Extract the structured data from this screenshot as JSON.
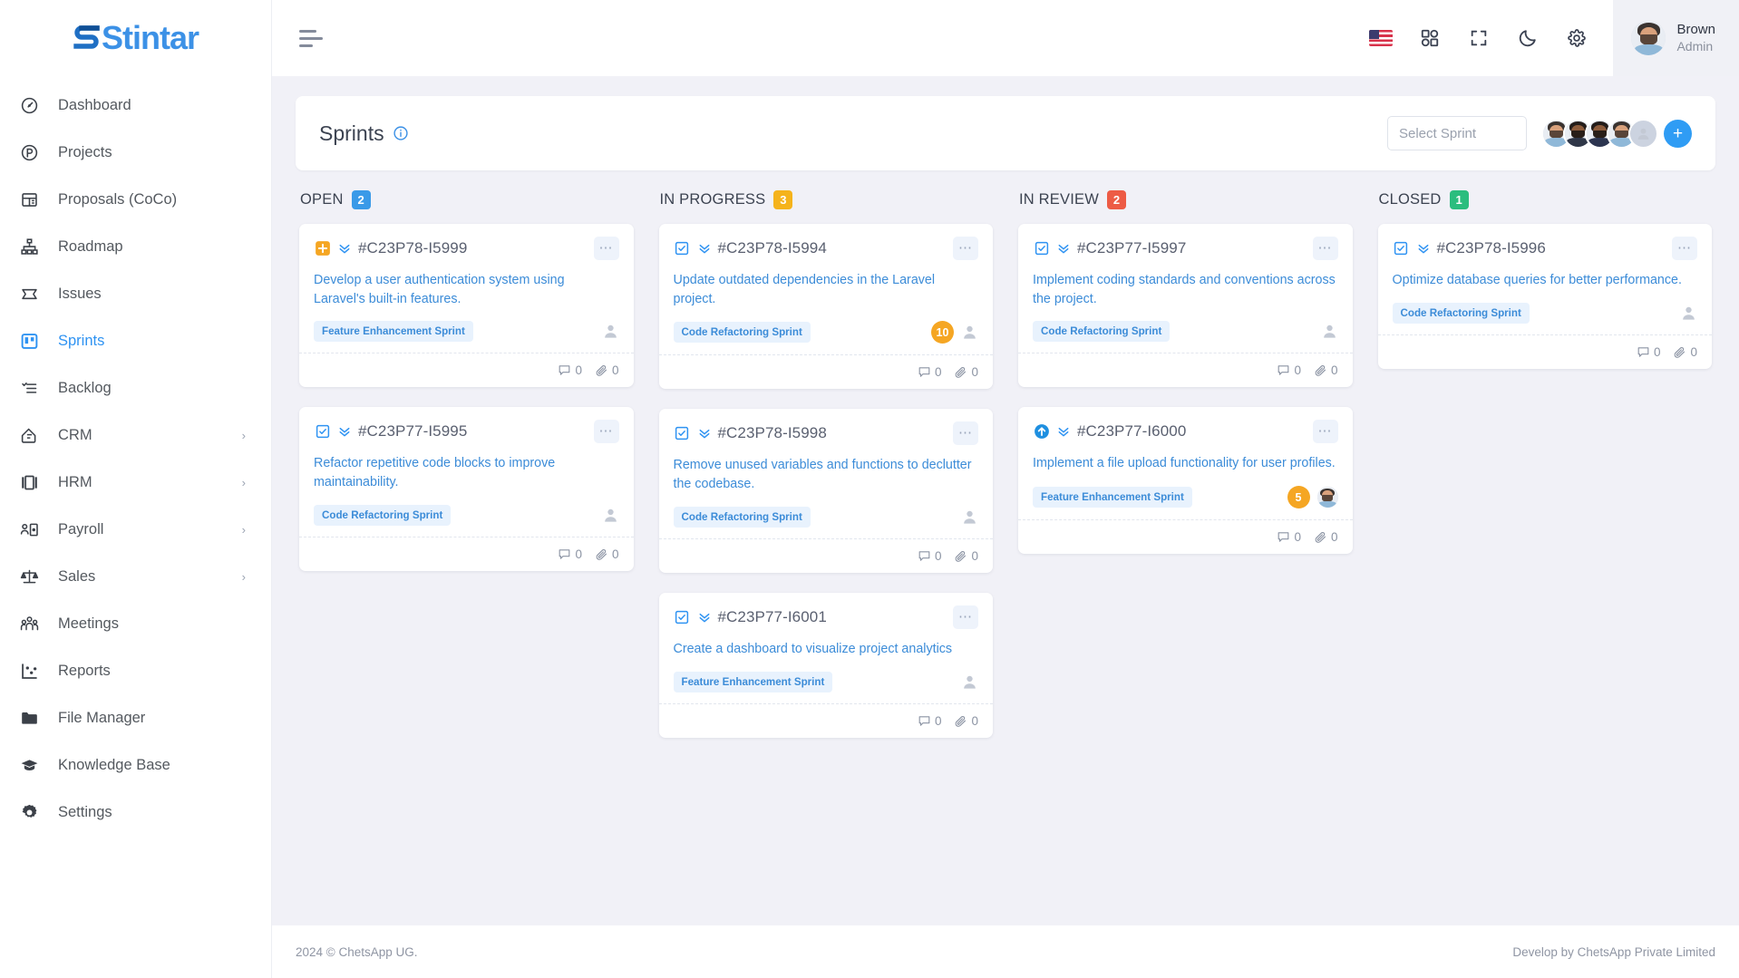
{
  "brand": {
    "logo_text": "Stintar",
    "accent": "#3c91e6"
  },
  "sidebar": {
    "items": [
      {
        "label": "Dashboard",
        "icon": "speedometer-icon",
        "has_chevron": false,
        "active": false
      },
      {
        "label": "Projects",
        "icon": "project-icon",
        "has_chevron": false,
        "active": false
      },
      {
        "label": "Proposals (CoCo)",
        "icon": "proposal-icon",
        "has_chevron": false,
        "active": false
      },
      {
        "label": "Roadmap",
        "icon": "roadmap-icon",
        "has_chevron": false,
        "active": false
      },
      {
        "label": "Issues",
        "icon": "issues-icon",
        "has_chevron": false,
        "active": false
      },
      {
        "label": "Sprints",
        "icon": "sprints-icon",
        "has_chevron": false,
        "active": true
      },
      {
        "label": "Backlog",
        "icon": "backlog-icon",
        "has_chevron": false,
        "active": false
      },
      {
        "label": "CRM",
        "icon": "crm-icon",
        "has_chevron": true,
        "active": false
      },
      {
        "label": "HRM",
        "icon": "hrm-icon",
        "has_chevron": true,
        "active": false
      },
      {
        "label": "Payroll",
        "icon": "payroll-icon",
        "has_chevron": true,
        "active": false
      },
      {
        "label": "Sales",
        "icon": "sales-icon",
        "has_chevron": true,
        "active": false
      },
      {
        "label": "Meetings",
        "icon": "meetings-icon",
        "has_chevron": false,
        "active": false
      },
      {
        "label": "Reports",
        "icon": "reports-icon",
        "has_chevron": false,
        "active": false
      },
      {
        "label": "File Manager",
        "icon": "folder-icon",
        "has_chevron": false,
        "active": false
      },
      {
        "label": "Knowledge Base",
        "icon": "graduation-icon",
        "has_chevron": false,
        "active": false
      },
      {
        "label": "Settings",
        "icon": "gear-icon",
        "has_chevron": false,
        "active": false
      }
    ],
    "chevron_glyph": "›"
  },
  "topbar": {
    "menu_icon": "hamburger-icon",
    "icons": [
      "flag-us-icon",
      "apps-grid-icon",
      "fullscreen-icon",
      "dark-mode-moon-icon",
      "gear-icon"
    ],
    "profile": {
      "name": "Brown",
      "role": "Admin"
    }
  },
  "page": {
    "title": "Sprints",
    "info_icon": "info-icon",
    "select_sprint_placeholder": "Select Sprint",
    "add_button_label": "+",
    "member_avatars": 4,
    "member_placeholder_avatar": true
  },
  "board": {
    "columns": [
      {
        "title": "OPEN",
        "count": "2",
        "count_color": "#3a9ae8",
        "cards": [
          {
            "type_icon": "plus-square-icon",
            "type_color": "#f5a623",
            "priority_icon": "double-chevron-down-icon",
            "id": "#C23P78-I5999",
            "description": "Develop a user authentication system using Laravel's built-in features.",
            "tag": "Feature Enhancement Sprint",
            "points": null,
            "assignee": "placeholder",
            "comments": "0",
            "attachments": "0"
          },
          {
            "type_icon": "task-clipboard-icon",
            "type_color": "#2f93f2",
            "priority_icon": "double-chevron-down-icon",
            "id": "#C23P77-I5995",
            "description": "Refactor repetitive code blocks to improve maintainability.",
            "tag": "Code Refactoring Sprint",
            "points": null,
            "assignee": "placeholder",
            "comments": "0",
            "attachments": "0"
          }
        ]
      },
      {
        "title": "IN PROGRESS",
        "count": "3",
        "count_color": "#f5b31b",
        "cards": [
          {
            "type_icon": "task-clipboard-icon",
            "type_color": "#2f93f2",
            "priority_icon": "double-chevron-down-icon",
            "id": "#C23P78-I5994",
            "description": "Update outdated dependencies in the Laravel project.",
            "tag": "Code Refactoring Sprint",
            "points": "10",
            "assignee": "placeholder",
            "comments": "0",
            "attachments": "0"
          },
          {
            "type_icon": "task-clipboard-icon",
            "type_color": "#2f93f2",
            "priority_icon": "double-chevron-down-icon",
            "id": "#C23P78-I5998",
            "description": "Remove unused variables and functions to declutter the codebase.",
            "tag": "Code Refactoring Sprint",
            "points": null,
            "assignee": "placeholder",
            "comments": "0",
            "attachments": "0"
          },
          {
            "type_icon": "task-clipboard-icon",
            "type_color": "#2f93f2",
            "priority_icon": "double-chevron-down-icon",
            "id": "#C23P77-I6001",
            "description": "Create a dashboard to visualize project analytics",
            "tag": "Feature Enhancement Sprint",
            "points": null,
            "assignee": "placeholder",
            "comments": "0",
            "attachments": "0"
          }
        ]
      },
      {
        "title": "IN REVIEW",
        "count": "2",
        "count_color": "#ed5b45",
        "cards": [
          {
            "type_icon": "task-clipboard-icon",
            "type_color": "#2f93f2",
            "priority_icon": "double-chevron-down-icon",
            "id": "#C23P77-I5997",
            "description": "Implement coding standards and conventions across the project.",
            "tag": "Code Refactoring Sprint",
            "points": null,
            "assignee": "placeholder",
            "comments": "0",
            "attachments": "0"
          },
          {
            "type_icon": "arrow-up-circle-icon",
            "type_color": "#1e8fe0",
            "priority_icon": "double-chevron-down-icon",
            "id": "#C23P77-I6000",
            "description": "Implement a file upload functionality for user profiles.",
            "tag": "Feature Enhancement Sprint",
            "points": "5",
            "assignee": "photo",
            "comments": "0",
            "attachments": "0"
          }
        ]
      },
      {
        "title": "CLOSED",
        "count": "1",
        "count_color": "#2bbd7e",
        "cards": [
          {
            "type_icon": "task-clipboard-icon",
            "type_color": "#2f93f2",
            "priority_icon": "double-chevron-down-icon",
            "id": "#C23P78-I5996",
            "description": "Optimize database queries for better performance.",
            "tag": "Code Refactoring Sprint",
            "points": null,
            "assignee": "placeholder",
            "comments": "0",
            "attachments": "0"
          }
        ]
      }
    ]
  },
  "footer": {
    "left": "2024 © ChetsApp UG.",
    "right": "Develop by ChetsApp Private Limited"
  }
}
